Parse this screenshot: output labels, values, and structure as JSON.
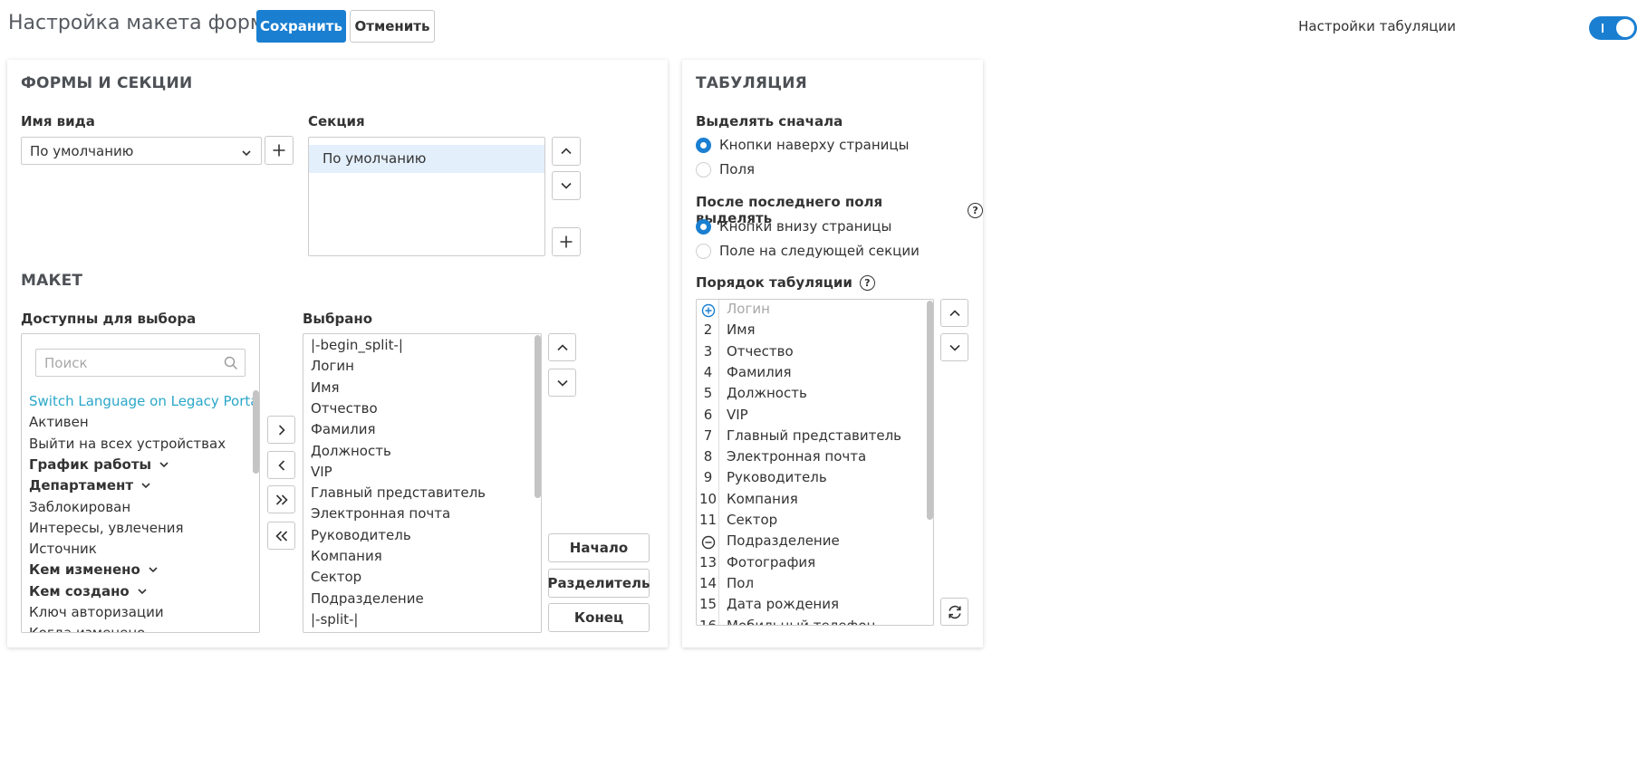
{
  "header": {
    "title": "Настройка макета формы",
    "save_label": "Сохранить",
    "cancel_label": "Отменить",
    "tab_settings_label": "Настройки табуляции",
    "tab_settings_on": true
  },
  "left_card": {
    "forms_title": "ФОРМЫ И СЕКЦИИ",
    "view_name_label": "Имя вида",
    "view_name_value": "По умолчанию",
    "section_label": "Секция",
    "sections": [
      "По умолчанию"
    ],
    "layout_title": "МАКЕТ",
    "available_label": "Доступны для выбора",
    "search_placeholder": "Поиск",
    "available_items": [
      {
        "label": "Switch Language on Legacy Portal",
        "bold": false,
        "expandable": false,
        "highlight": true
      },
      {
        "label": "Активен",
        "bold": false,
        "expandable": false
      },
      {
        "label": "Выйти на всех устройствах",
        "bold": false,
        "expandable": false
      },
      {
        "label": "График работы",
        "bold": true,
        "expandable": true
      },
      {
        "label": "Департамент",
        "bold": true,
        "expandable": true
      },
      {
        "label": "Заблокирован",
        "bold": false,
        "expandable": false
      },
      {
        "label": "Интересы, увлечения",
        "bold": false,
        "expandable": false
      },
      {
        "label": "Источник",
        "bold": false,
        "expandable": false
      },
      {
        "label": "Кем изменено",
        "bold": true,
        "expandable": true
      },
      {
        "label": "Кем создано",
        "bold": true,
        "expandable": true
      },
      {
        "label": "Ключ авторизации",
        "bold": false,
        "expandable": false
      },
      {
        "label": "Когда изменено",
        "bold": false,
        "expandable": false
      }
    ],
    "selected_label": "Выбрано",
    "selected_items": [
      "|-begin_split-|",
      "Логин",
      "Имя",
      "Отчество",
      "Фамилия",
      "Должность",
      "VIP",
      "Главный представитель",
      "Электронная почта",
      "Руководитель",
      "Компания",
      "Сектор",
      "Подразделение",
      "|-split-|"
    ],
    "start_label": "Начало",
    "separator_label": "Разделитель",
    "end_label": "Конец"
  },
  "right_card": {
    "title": "ТАБУЛЯЦИЯ",
    "highlight_first_label": "Выделять сначала",
    "highlight_first_options": [
      {
        "label": "Кнопки наверху страницы",
        "selected": true
      },
      {
        "label": "Поля",
        "selected": false
      }
    ],
    "after_last_label": "После последнего поля выделять",
    "after_last_options": [
      {
        "label": "Кнопки внизу страницы",
        "selected": true
      },
      {
        "label": "Поле на следующей секции",
        "selected": false
      }
    ],
    "order_label": "Порядок табуляции",
    "help_glyph": "?",
    "order_items": [
      {
        "num": "",
        "icon": "plus-circle",
        "label": "Логин",
        "muted": true
      },
      {
        "num": "2",
        "label": "Имя"
      },
      {
        "num": "3",
        "label": "Отчество"
      },
      {
        "num": "4",
        "label": "Фамилия"
      },
      {
        "num": "5",
        "label": "Должность"
      },
      {
        "num": "6",
        "label": "VIP"
      },
      {
        "num": "7",
        "label": "Главный представитель"
      },
      {
        "num": "8",
        "label": "Электронная почта"
      },
      {
        "num": "9",
        "label": "Руководитель"
      },
      {
        "num": "10",
        "label": "Компания"
      },
      {
        "num": "11",
        "label": "Сектор"
      },
      {
        "num": "",
        "icon": "minus-circle",
        "label": "Подразделение"
      },
      {
        "num": "13",
        "label": "Фотография"
      },
      {
        "num": "14",
        "label": "Пол"
      },
      {
        "num": "15",
        "label": "Дата рождения"
      },
      {
        "num": "16",
        "label": "Мобильный телефон"
      }
    ]
  },
  "colors": {
    "accent": "#1a7fd1",
    "link": "#2aa7c8",
    "selected_bg": "#e4effc",
    "muted": "#a8a8a8"
  }
}
